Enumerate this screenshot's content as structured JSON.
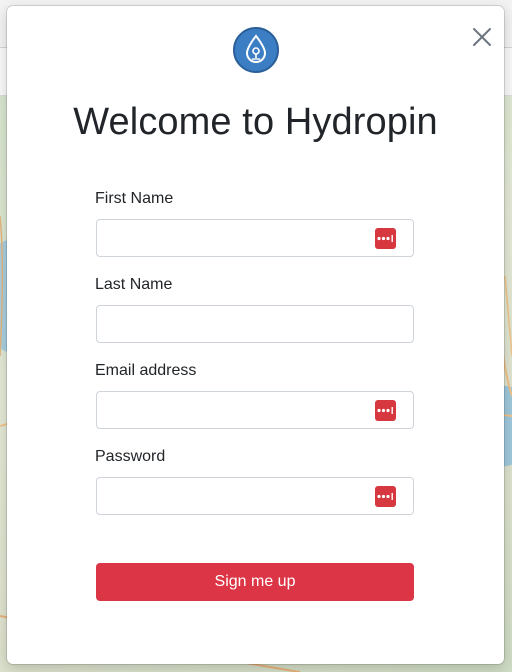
{
  "modal": {
    "title": "Welcome to Hydropin",
    "logo_icon": "water-drop-pin-icon",
    "close_icon": "close-icon"
  },
  "form": {
    "fields": [
      {
        "label": "First Name",
        "value": "",
        "has_password_manager_icon": true
      },
      {
        "label": "Last Name",
        "value": "",
        "has_password_manager_icon": false
      },
      {
        "label": "Email address",
        "value": "",
        "has_password_manager_icon": true
      },
      {
        "label": "Password",
        "value": "",
        "has_password_manager_icon": true
      }
    ],
    "submit_label": "Sign me up"
  },
  "colors": {
    "primary_button": "#dc3545",
    "logo_blue": "#3b7ec4",
    "password_manager_icon": "#d7373f",
    "title_text": "#212529"
  }
}
